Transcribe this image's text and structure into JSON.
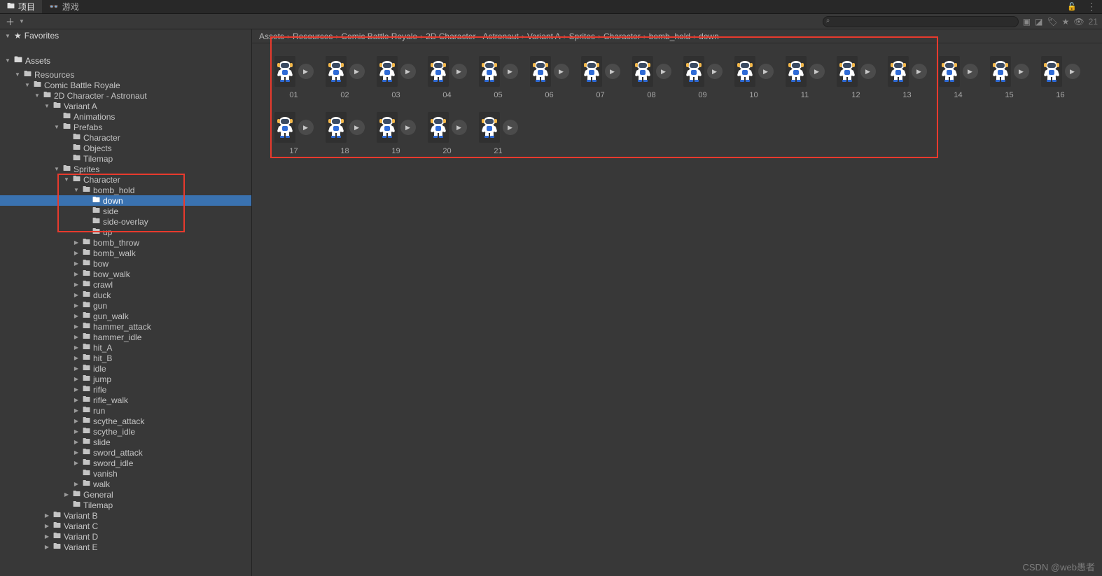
{
  "tabs": {
    "project": "项目",
    "game": "游戏"
  },
  "toolbar": {
    "search_placeholder": "",
    "hidden_label": "21"
  },
  "favorites_label": "Favorites",
  "assets_root_label": "Assets",
  "tree": [
    {
      "d": 1,
      "a": "d",
      "i": "📁",
      "t": "Resources"
    },
    {
      "d": 2,
      "a": "d",
      "i": "📁",
      "t": "Comic Battle Royale"
    },
    {
      "d": 3,
      "a": "d",
      "i": "📁",
      "t": "2D Character - Astronaut"
    },
    {
      "d": 4,
      "a": "d",
      "i": "📁",
      "t": "Variant A"
    },
    {
      "d": 5,
      "a": "n",
      "i": "📁",
      "t": "Animations"
    },
    {
      "d": 5,
      "a": "d",
      "i": "📁",
      "t": "Prefabs"
    },
    {
      "d": 6,
      "a": "n",
      "i": "📁",
      "t": "Character"
    },
    {
      "d": 6,
      "a": "n",
      "i": "📁",
      "t": "Objects"
    },
    {
      "d": 6,
      "a": "n",
      "i": "📁",
      "t": "Tilemap"
    },
    {
      "d": 5,
      "a": "d",
      "i": "📁",
      "t": "Sprites"
    },
    {
      "d": 6,
      "a": "d",
      "i": "📁",
      "t": "Character"
    },
    {
      "d": 7,
      "a": "d",
      "i": "📁",
      "t": "bomb_hold"
    },
    {
      "d": 8,
      "a": "n",
      "i": "📁",
      "t": "down",
      "sel": true
    },
    {
      "d": 8,
      "a": "n",
      "i": "📁",
      "t": "side"
    },
    {
      "d": 8,
      "a": "n",
      "i": "📁",
      "t": "side-overlay"
    },
    {
      "d": 8,
      "a": "n",
      "i": "📁",
      "t": "up"
    },
    {
      "d": 7,
      "a": "r",
      "i": "📁",
      "t": "bomb_throw"
    },
    {
      "d": 7,
      "a": "r",
      "i": "📁",
      "t": "bomb_walk"
    },
    {
      "d": 7,
      "a": "r",
      "i": "📁",
      "t": "bow"
    },
    {
      "d": 7,
      "a": "r",
      "i": "📁",
      "t": "bow_walk"
    },
    {
      "d": 7,
      "a": "r",
      "i": "📁",
      "t": "crawl"
    },
    {
      "d": 7,
      "a": "r",
      "i": "📁",
      "t": "duck"
    },
    {
      "d": 7,
      "a": "r",
      "i": "📁",
      "t": "gun"
    },
    {
      "d": 7,
      "a": "r",
      "i": "📁",
      "t": "gun_walk"
    },
    {
      "d": 7,
      "a": "r",
      "i": "📁",
      "t": "hammer_attack"
    },
    {
      "d": 7,
      "a": "r",
      "i": "📁",
      "t": "hammer_idle"
    },
    {
      "d": 7,
      "a": "r",
      "i": "📁",
      "t": "hit_A"
    },
    {
      "d": 7,
      "a": "r",
      "i": "📁",
      "t": "hit_B"
    },
    {
      "d": 7,
      "a": "r",
      "i": "📁",
      "t": "idle"
    },
    {
      "d": 7,
      "a": "r",
      "i": "📁",
      "t": "jump"
    },
    {
      "d": 7,
      "a": "r",
      "i": "📁",
      "t": "rifle"
    },
    {
      "d": 7,
      "a": "r",
      "i": "📁",
      "t": "rifle_walk"
    },
    {
      "d": 7,
      "a": "r",
      "i": "📁",
      "t": "run"
    },
    {
      "d": 7,
      "a": "r",
      "i": "📁",
      "t": "scythe_attack"
    },
    {
      "d": 7,
      "a": "r",
      "i": "📁",
      "t": "scythe_idle"
    },
    {
      "d": 7,
      "a": "r",
      "i": "📁",
      "t": "slide"
    },
    {
      "d": 7,
      "a": "r",
      "i": "📁",
      "t": "sword_attack"
    },
    {
      "d": 7,
      "a": "r",
      "i": "📁",
      "t": "sword_idle"
    },
    {
      "d": 7,
      "a": "n",
      "i": "📁",
      "t": "vanish"
    },
    {
      "d": 7,
      "a": "r",
      "i": "📁",
      "t": "walk"
    },
    {
      "d": 6,
      "a": "r",
      "i": "📁",
      "t": "General"
    },
    {
      "d": 6,
      "a": "n",
      "i": "📁",
      "t": "Tilemap"
    },
    {
      "d": 4,
      "a": "r",
      "i": "📁",
      "t": "Variant B"
    },
    {
      "d": 4,
      "a": "r",
      "i": "📁",
      "t": "Variant C"
    },
    {
      "d": 4,
      "a": "r",
      "i": "📁",
      "t": "Variant D"
    },
    {
      "d": 4,
      "a": "r",
      "i": "📁",
      "t": "Variant E"
    }
  ],
  "breadcrumb": [
    "Assets",
    "Resources",
    "Comic Battle Royale",
    "2D Character - Astronaut",
    "Variant A",
    "Sprites",
    "Character",
    "bomb_hold",
    "down"
  ],
  "sprites": [
    "01",
    "02",
    "03",
    "04",
    "05",
    "06",
    "07",
    "08",
    "09",
    "10",
    "11",
    "12",
    "13",
    "14",
    "15",
    "16",
    "17",
    "18",
    "19",
    "20",
    "21"
  ],
  "watermark": "CSDN @web愚者"
}
